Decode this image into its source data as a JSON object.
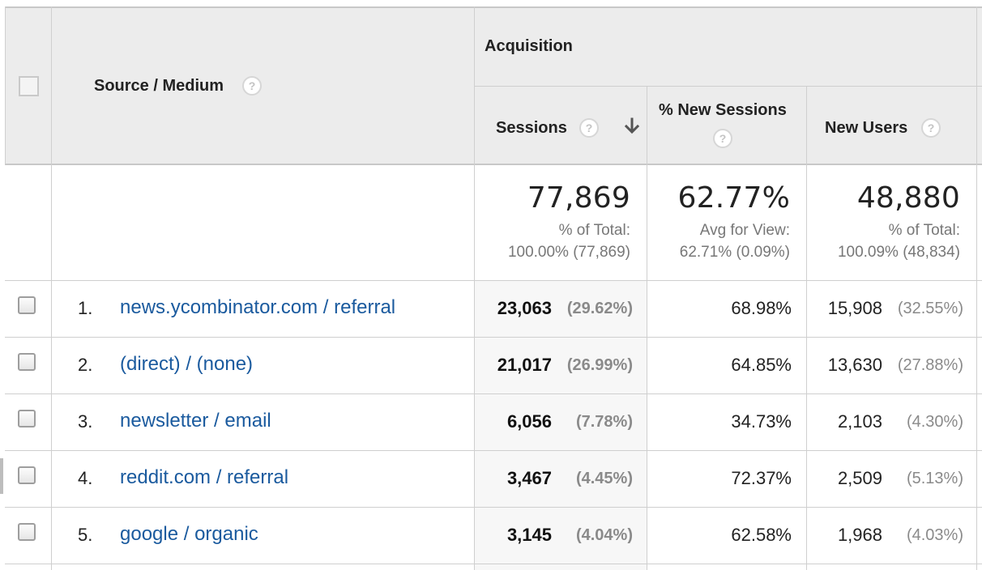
{
  "header": {
    "source_medium_label": "Source / Medium",
    "acquisition_label": "Acquisition",
    "sessions_label": "Sessions",
    "pct_new_sessions_label": "% New Sessions",
    "new_users_label": "New Users",
    "help_glyph": "?"
  },
  "totals": {
    "sessions": {
      "value": "77,869",
      "line1": "% of Total:",
      "line2": "100.00% (77,869)"
    },
    "pct_new_sessions": {
      "value": "62.77%",
      "line1": "Avg for View:",
      "line2": "62.71% (0.09%)"
    },
    "new_users": {
      "value": "48,880",
      "line1": "% of Total:",
      "line2": "100.09% (48,834)"
    }
  },
  "rows": [
    {
      "rank": "1.",
      "source": "news.ycombinator.com / referral",
      "sessions": "23,063",
      "sessions_pct": "(29.62%)",
      "pct_new": "68.98%",
      "new_users": "15,908",
      "new_users_pct": "(32.55%)"
    },
    {
      "rank": "2.",
      "source": "(direct) / (none)",
      "sessions": "21,017",
      "sessions_pct": "(26.99%)",
      "pct_new": "64.85%",
      "new_users": "13,630",
      "new_users_pct": "(27.88%)"
    },
    {
      "rank": "3.",
      "source": "newsletter / email",
      "sessions": "6,056",
      "sessions_pct": "(7.78%)",
      "pct_new": "34.73%",
      "new_users": "2,103",
      "new_users_pct": "(4.30%)"
    },
    {
      "rank": "4.",
      "source": "reddit.com / referral",
      "sessions": "3,467",
      "sessions_pct": "(4.45%)",
      "pct_new": "72.37%",
      "new_users": "2,509",
      "new_users_pct": "(5.13%)"
    },
    {
      "rank": "5.",
      "source": "google / organic",
      "sessions": "3,145",
      "sessions_pct": "(4.04%)",
      "pct_new": "62.58%",
      "new_users": "1,968",
      "new_users_pct": "(4.03%)"
    }
  ],
  "colors": {
    "header_bg": "#ececec",
    "link": "#1a5a9e",
    "grid": "#cfcfcf",
    "muted": "#8a8a8a"
  }
}
